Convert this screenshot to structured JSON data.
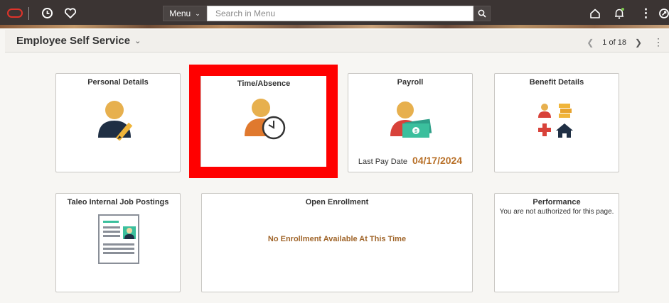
{
  "topbar": {
    "menu_label": "Menu",
    "search_placeholder": "Search in Menu"
  },
  "subheader": {
    "homepage_title": "Employee Self Service",
    "pager_text": "1 of 18"
  },
  "tiles": [
    {
      "title": "Personal Details"
    },
    {
      "title": "Time/Absence"
    },
    {
      "title": "Payroll",
      "last_pay_label": "Last Pay Date",
      "last_pay_date": "04/17/2024"
    },
    {
      "title": "Benefit Details"
    },
    {
      "title": "Taleo Internal Job Postings"
    },
    {
      "title": "Open Enrollment",
      "message": "No Enrollment Available At This Time"
    },
    {
      "title": "Performance",
      "message": "You are not authorized for this page."
    }
  ],
  "colors": {
    "topbar": "#3b3433",
    "highlight": "#ff0000",
    "accent_orange": "#b87028"
  }
}
